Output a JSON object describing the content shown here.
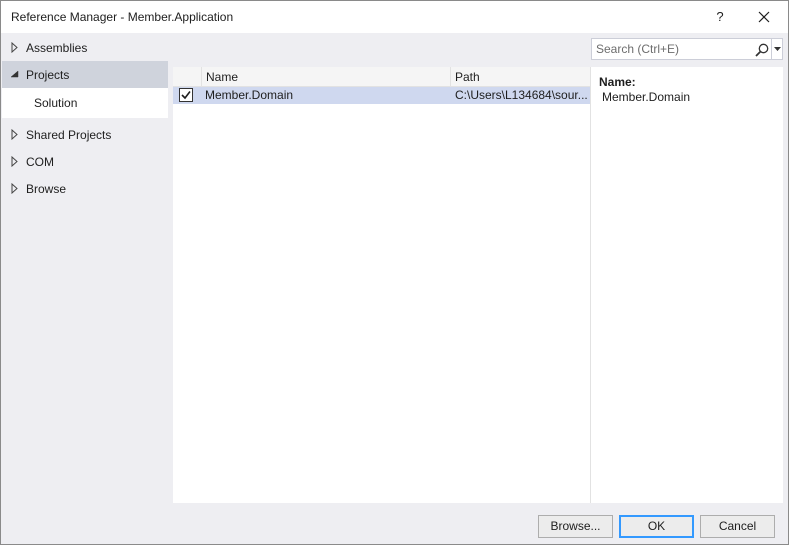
{
  "window": {
    "title": "Reference Manager - Member.Application",
    "help_label": "?"
  },
  "sidebar": {
    "items": [
      {
        "label": "Assemblies",
        "arrow": "collapsed-triangle-icon"
      },
      {
        "label": "Projects",
        "arrow": "expanded-triangle-icon",
        "selected": true
      },
      {
        "label": "Solution",
        "sub": true
      },
      {
        "label": "Shared Projects",
        "arrow": "collapsed-triangle-icon"
      },
      {
        "label": "COM",
        "arrow": "collapsed-triangle-icon"
      },
      {
        "label": "Browse",
        "arrow": "collapsed-triangle-icon"
      }
    ]
  },
  "search": {
    "placeholder": "Search (Ctrl+E)"
  },
  "list": {
    "columns": [
      "Name",
      "Path"
    ],
    "rows": [
      {
        "checked": true,
        "name": "Member.Domain",
        "path": "C:\\Users\\L134684\\sour..."
      }
    ]
  },
  "details": {
    "name_label": "Name:",
    "name_value": "Member.Domain"
  },
  "buttons": {
    "browse": "Browse...",
    "ok": "OK",
    "cancel": "Cancel"
  },
  "colors": {
    "selection": "#cfd8ef",
    "nav_selected": "#cfd3dc",
    "background": "#eeeef2",
    "primary_border": "#3399ff"
  }
}
